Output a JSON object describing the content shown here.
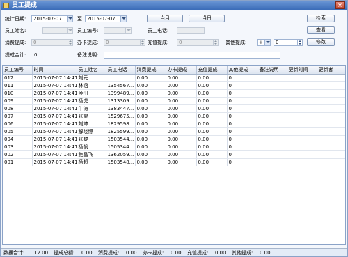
{
  "window": {
    "title": "员工提成",
    "close_label": "×"
  },
  "filters": {
    "date_label": "统计日期:",
    "date_from": "2015-07-07",
    "to_label": "至",
    "date_to": "2015-07-07",
    "btn_month": "当月",
    "btn_day": "当日",
    "btn_search": "检索",
    "btn_view": "查看",
    "btn_edit": "修改",
    "name_label": "员工姓名:",
    "name_value": "",
    "id_label": "员工编号:",
    "id_value": "",
    "phone_label": "员工电话:",
    "phone_value": "",
    "consume_label": "消费提成:",
    "consume_value": "0",
    "card_label": "办卡提成:",
    "card_value": "0",
    "recharge_label": "充值提成:",
    "recharge_value": "0",
    "other_label": "其他提成:",
    "other_sign": "+",
    "other_value": "0",
    "total_label": "提成合计:",
    "total_value": "0",
    "note_label": "备注说明:",
    "note_value": ""
  },
  "table": {
    "columns": [
      "员工编号",
      "时间",
      "员工姓名",
      "员工电话",
      "消费提成",
      "办卡提成",
      "充值提成",
      "其他提成",
      "备注说明",
      "更新时间",
      "更新者"
    ],
    "rows": [
      [
        "012",
        "2015-07-07 14:41",
        "刘元",
        "",
        "0.00",
        "0.00",
        "0.00",
        "0",
        "",
        "",
        ""
      ],
      [
        "011",
        "2015-07-07 14:41",
        "林涵",
        "1354567...",
        "0.00",
        "0.00",
        "0.00",
        "0",
        "",
        "",
        ""
      ],
      [
        "010",
        "2015-07-07 14:41",
        "侯川",
        "1399489...",
        "0.00",
        "0.00",
        "0.00",
        "0",
        "",
        "",
        ""
      ],
      [
        "009",
        "2015-07-07 14:41",
        "杨虎",
        "1313309...",
        "0.00",
        "0.00",
        "0.00",
        "0",
        "",
        "",
        ""
      ],
      [
        "008",
        "2015-07-07 14:41",
        "牛涛",
        "1383447...",
        "0.00",
        "0.00",
        "0.00",
        "0",
        "",
        "",
        ""
      ],
      [
        "007",
        "2015-07-07 14:41",
        "张望",
        "1529675...",
        "0.00",
        "0.00",
        "0.00",
        "0",
        "",
        "",
        ""
      ],
      [
        "006",
        "2015-07-07 14:41",
        "刘婷",
        "1829598...",
        "0.00",
        "0.00",
        "0.00",
        "0",
        "",
        "",
        ""
      ],
      [
        "005",
        "2015-07-07 14:41",
        "解晓博",
        "1825599...",
        "0.00",
        "0.00",
        "0.00",
        "0",
        "",
        "",
        ""
      ],
      [
        "004",
        "2015-07-07 14:41",
        "张黎",
        "1503544...",
        "0.00",
        "0.00",
        "0.00",
        "0",
        "",
        "",
        ""
      ],
      [
        "003",
        "2015-07-07 14:41",
        "杨帆",
        "1505344...",
        "0.00",
        "0.00",
        "0.00",
        "0",
        "",
        "",
        ""
      ],
      [
        "002",
        "2015-07-07 14:41",
        "鲍昌飞",
        "1362059...",
        "0.00",
        "0.00",
        "0.00",
        "0",
        "",
        "",
        ""
      ],
      [
        "001",
        "2015-07-07 14:41",
        "杨超",
        "1503548...",
        "0.00",
        "0.00",
        "0.00",
        "0",
        "",
        "",
        ""
      ]
    ]
  },
  "status": {
    "count_label": "数据合计:",
    "count_value": "12.00",
    "total_label": "提成总额:",
    "total_value": "0.00",
    "consume_label": "消费提成:",
    "consume_value": "0.00",
    "card_label": "办卡提成:",
    "card_value": "0.00",
    "recharge_label": "充值提成:",
    "recharge_value": "0.00",
    "other_label": "其他提成:",
    "other_value": "0.00"
  },
  "colors": {
    "titlebar": "#3b6cb8",
    "background": "#f4f7fc"
  },
  "icons": {
    "title": "window-app-icon",
    "close": "close-icon"
  }
}
